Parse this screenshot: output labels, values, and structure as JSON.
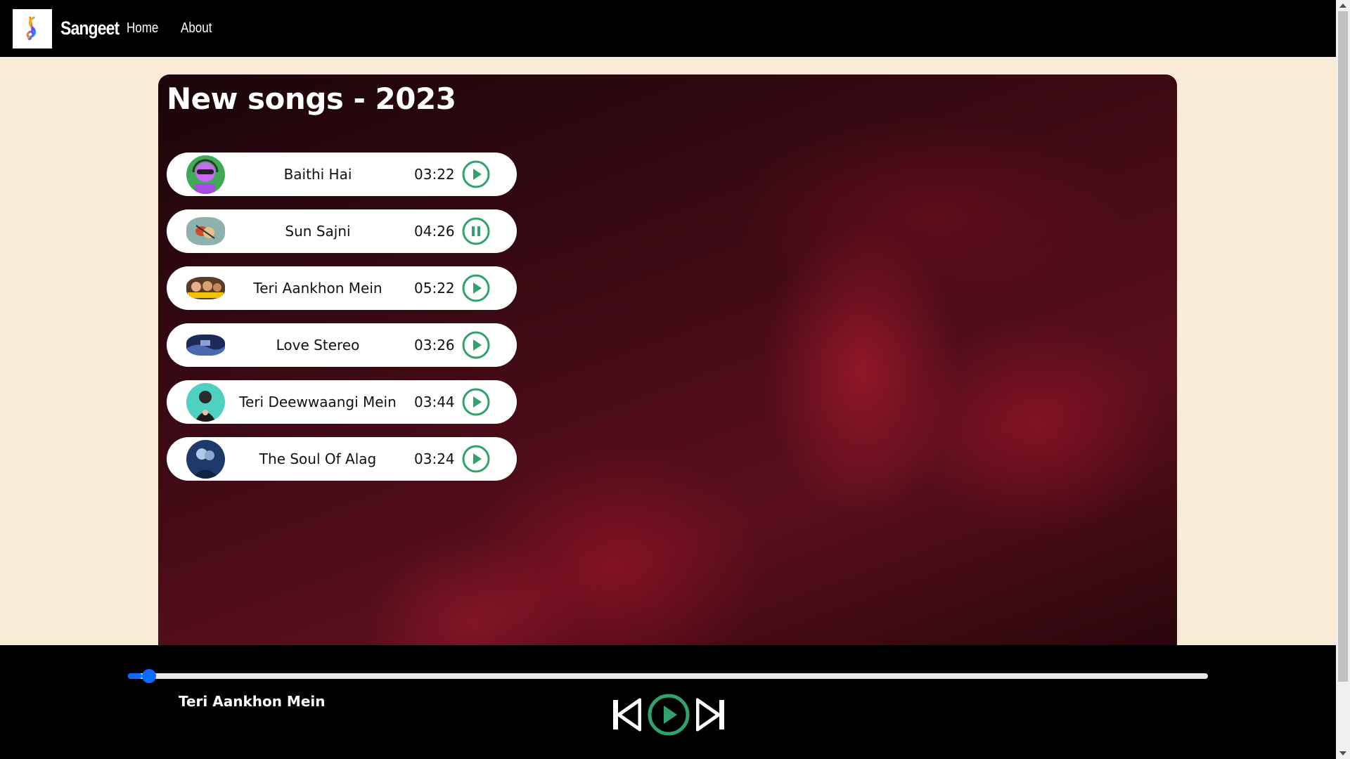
{
  "nav": {
    "brand": "Sangeet",
    "links": [
      "Home",
      "About"
    ]
  },
  "colors": {
    "accent_green": "#2fa36b",
    "progress_blue": "#0a6cff"
  },
  "main": {
    "title": "New songs - 2023",
    "songs": [
      {
        "name": "Baithi Hai",
        "duration": "03:22",
        "state": "play",
        "thumb": "purple-headphones-avatar"
      },
      {
        "name": "Sun Sajni",
        "duration": "04:26",
        "state": "pause",
        "thumb": "couple-art"
      },
      {
        "name": "Teri Aankhon Mein",
        "duration": "05:22",
        "state": "play",
        "thumb": "movie-poster"
      },
      {
        "name": "Love Stereo",
        "duration": "03:26",
        "state": "play",
        "thumb": "blue-landscape"
      },
      {
        "name": "Teri Deewwaangi Mein",
        "duration": "03:44",
        "state": "play",
        "thumb": "teal-portrait"
      },
      {
        "name": "The Soul Of Alag",
        "duration": "03:24",
        "state": "play",
        "thumb": "blue-couple"
      }
    ]
  },
  "player": {
    "now_playing": "Teri Aankhon Mein",
    "progress_fraction": 0.013,
    "state": "paused"
  }
}
